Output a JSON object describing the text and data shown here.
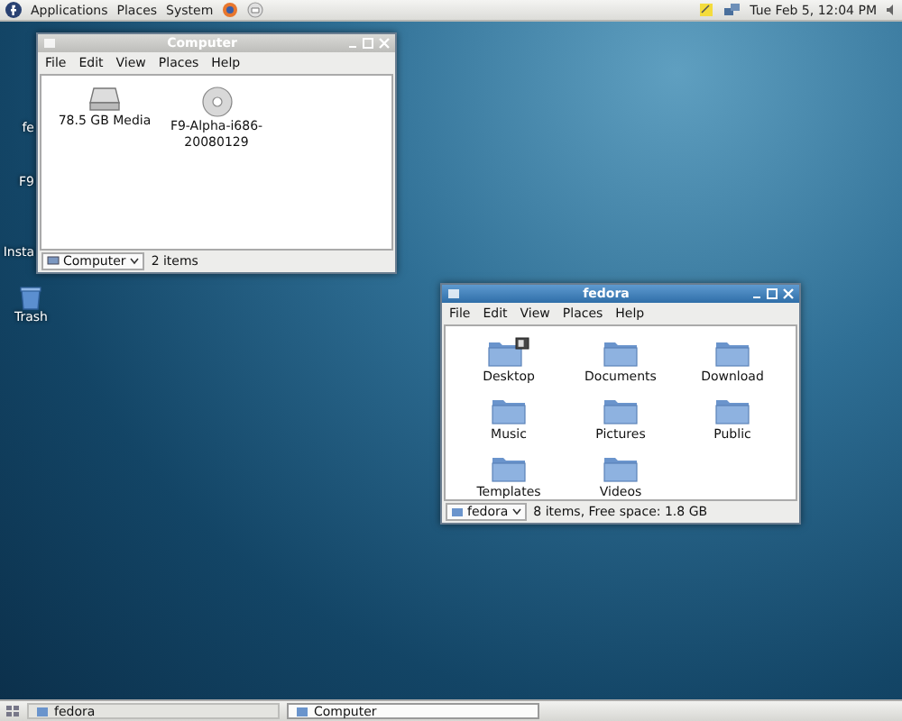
{
  "top_panel": {
    "menus": [
      "Applications",
      "Places",
      "System"
    ],
    "clock": "Tue Feb  5, 12:04 PM"
  },
  "desktop_icons": [
    {
      "label": "fe",
      "kind": "covered"
    },
    {
      "label": "F9",
      "kind": "covered"
    },
    {
      "label": "Insta",
      "kind": "covered"
    },
    {
      "label": "Trash",
      "kind": "trash"
    }
  ],
  "windows": [
    {
      "title": "Computer",
      "active": false,
      "menu": [
        "File",
        "Edit",
        "View",
        "Places",
        "Help"
      ],
      "items": [
        {
          "label": "78.5 GB Media",
          "kind": "drive"
        },
        {
          "label": "F9-Alpha-i686-20080129",
          "kind": "disc"
        }
      ],
      "location": "Computer",
      "status": "2 items"
    },
    {
      "title": "fedora",
      "active": true,
      "menu": [
        "File",
        "Edit",
        "View",
        "Places",
        "Help"
      ],
      "items": [
        {
          "label": "Desktop",
          "kind": "desktop-folder"
        },
        {
          "label": "Documents",
          "kind": "folder"
        },
        {
          "label": "Download",
          "kind": "folder"
        },
        {
          "label": "Music",
          "kind": "folder"
        },
        {
          "label": "Pictures",
          "kind": "folder"
        },
        {
          "label": "Public",
          "kind": "folder"
        },
        {
          "label": "Templates",
          "kind": "folder"
        },
        {
          "label": "Videos",
          "kind": "folder"
        }
      ],
      "location": "fedora",
      "status": "8 items, Free space: 1.8 GB"
    }
  ],
  "taskbar": [
    {
      "label": "fedora",
      "selected": false
    },
    {
      "label": "Computer",
      "selected": true
    }
  ]
}
